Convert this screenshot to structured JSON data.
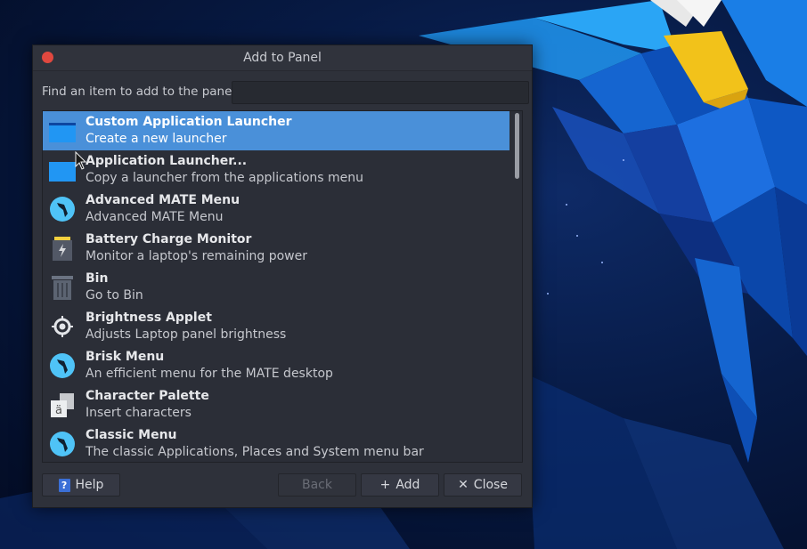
{
  "dialog": {
    "title": "Add to Panel",
    "find_label": "Find an item to add to the panel:",
    "find_value": "",
    "items": [
      {
        "name": "Custom Application Launcher",
        "desc": "Create a new launcher",
        "icon": "custom-launcher-icon",
        "selected": true
      },
      {
        "name": "Application Launcher...",
        "desc": "Copy a launcher from the applications menu",
        "icon": "app-launcher-icon",
        "selected": false
      },
      {
        "name": "Advanced MATE Menu",
        "desc": "Advanced MATE Menu",
        "icon": "kali-dragon-icon",
        "selected": false
      },
      {
        "name": "Battery Charge Monitor",
        "desc": "Monitor a laptop's remaining power",
        "icon": "battery-icon",
        "selected": false
      },
      {
        "name": "Bin",
        "desc": "Go to Bin",
        "icon": "trash-bin-icon",
        "selected": false
      },
      {
        "name": "Brightness Applet",
        "desc": "Adjusts Laptop panel brightness",
        "icon": "brightness-icon",
        "selected": false
      },
      {
        "name": "Brisk Menu",
        "desc": "An efficient menu for the MATE desktop",
        "icon": "kali-dragon-icon",
        "selected": false
      },
      {
        "name": "Character Palette",
        "desc": "Insert characters",
        "icon": "character-palette-icon",
        "selected": false
      },
      {
        "name": "Classic Menu",
        "desc": "The classic Applications, Places and System menu bar",
        "icon": "kali-dragon-icon",
        "selected": false
      }
    ],
    "buttons": {
      "help": "Help",
      "back": "Back",
      "add": "Add",
      "close": "Close"
    }
  },
  "colors": {
    "selection": "#4a90d9",
    "dialog_bg": "#2e313a",
    "close_dot": "#e0483f"
  }
}
